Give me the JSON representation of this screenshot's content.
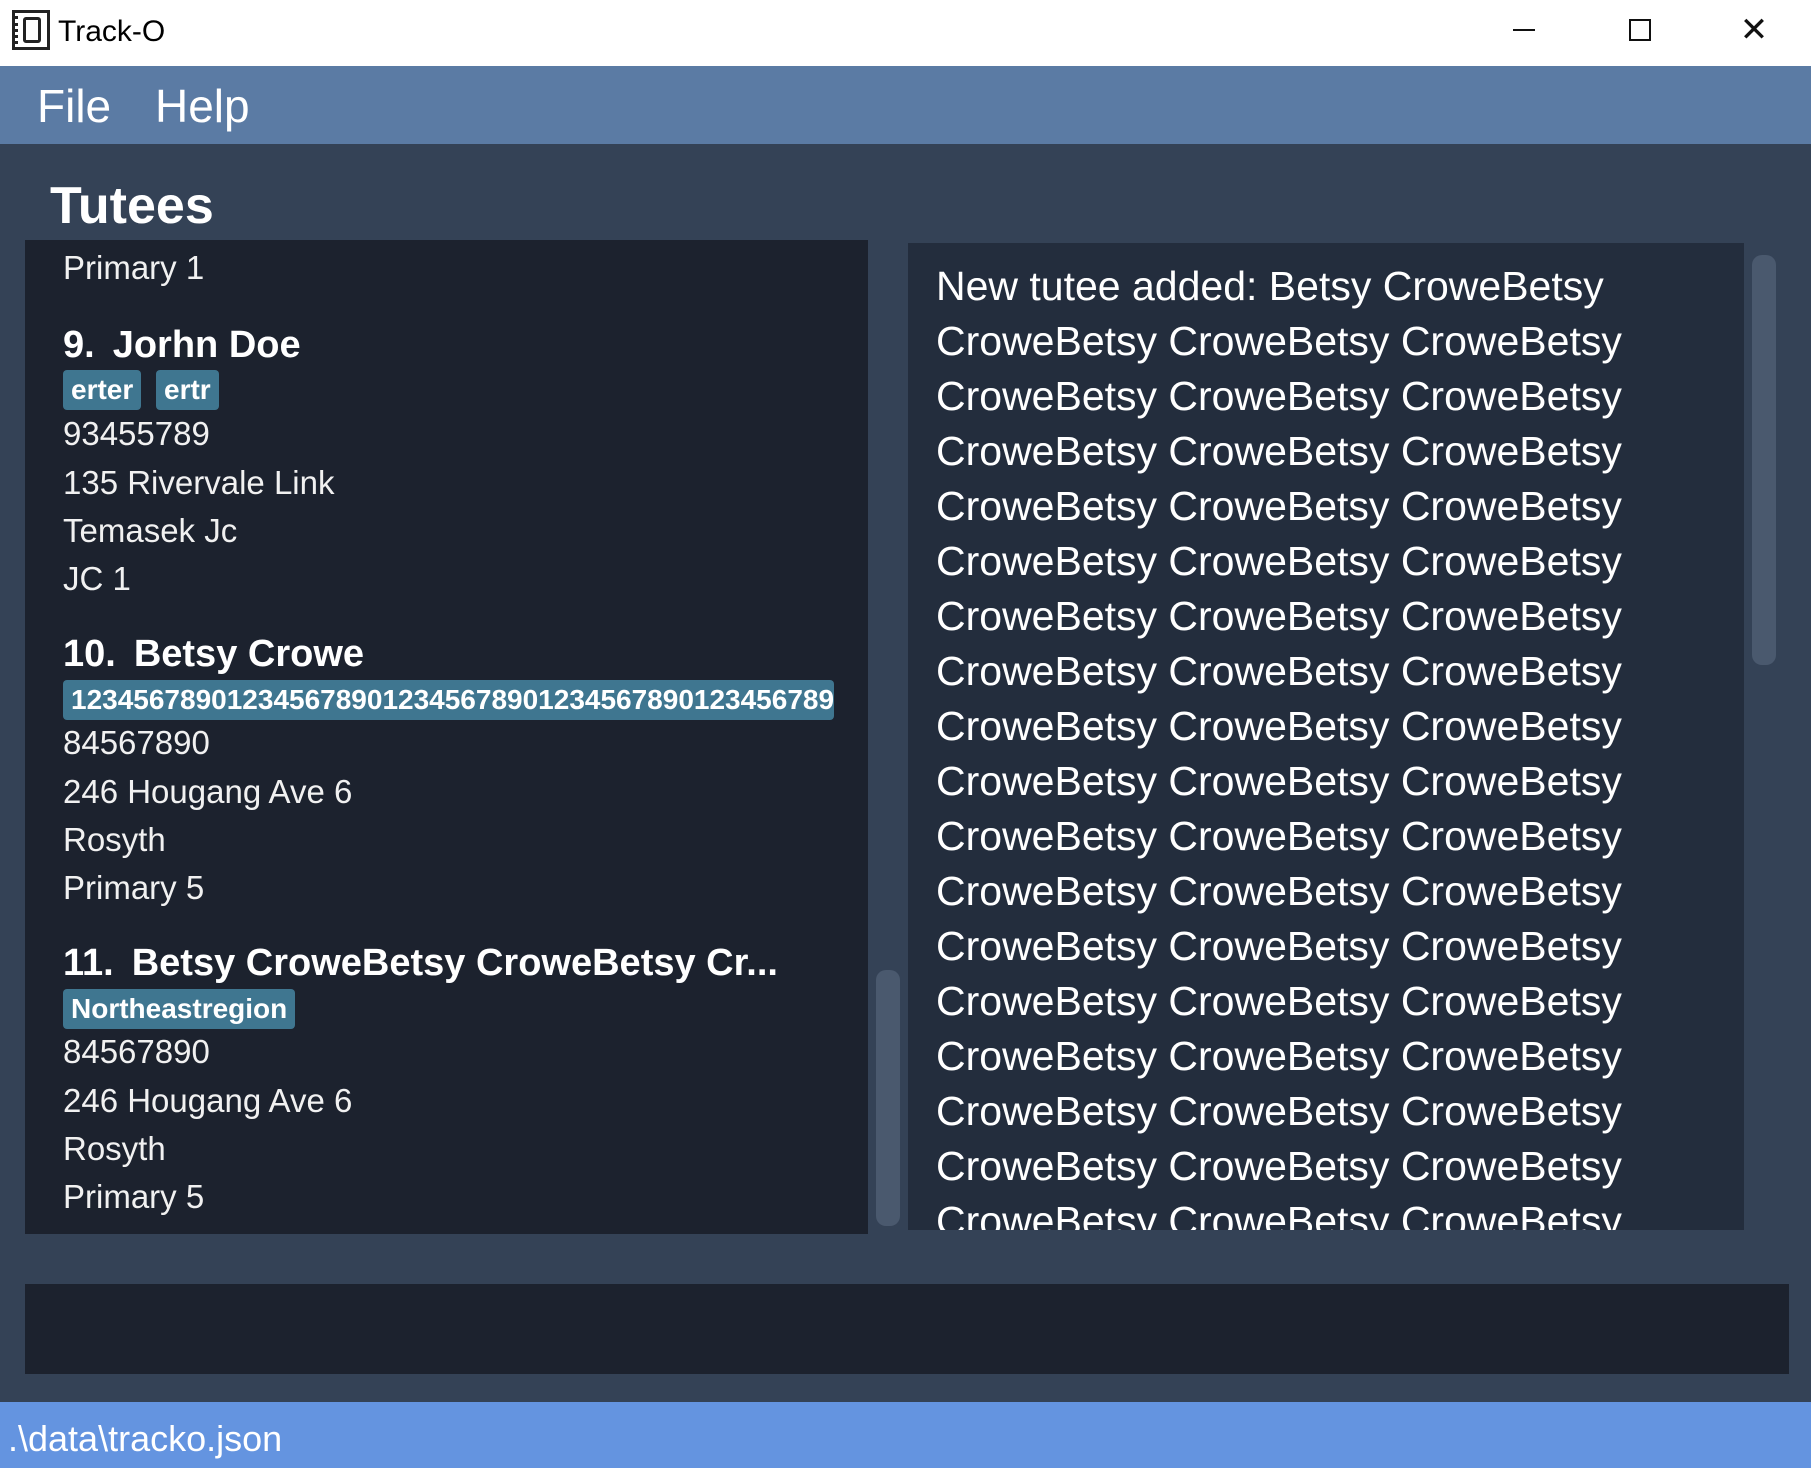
{
  "window": {
    "title": "Track-O",
    "minimize_label": "",
    "maximize_label": "",
    "close_glyph": "✕"
  },
  "menu": {
    "file": "File",
    "help": "Help"
  },
  "heading": "Tutees",
  "tutees": {
    "prev_tail": "Primary 1",
    "t9": {
      "index": "9.",
      "name": "Jorhn Doe",
      "tags": [
        "erter",
        "ertr"
      ],
      "phone": "93455789",
      "address": "135 Rivervale Link",
      "school": "Temasek Jc",
      "level": "JC 1"
    },
    "t10": {
      "index": "10.",
      "name": "Betsy Crowe",
      "tags": [
        "1234567890123456789012345678901234567890123456789"
      ],
      "phone": "84567890",
      "address": "246 Hougang Ave 6",
      "school": "Rosyth",
      "level": "Primary 5"
    },
    "t11": {
      "index": "11.",
      "name": "Betsy CroweBetsy CroweBetsy Cr...",
      "tags": [
        "Northeastregion"
      ],
      "phone": "84567890",
      "address": "246 Hougang Ave 6",
      "school": "Rosyth",
      "level": "Primary 5"
    }
  },
  "result": {
    "lines": [
      "New tutee added: Betsy CroweBetsy",
      "CroweBetsy CroweBetsy CroweBetsy",
      "CroweBetsy CroweBetsy CroweBetsy",
      "CroweBetsy CroweBetsy CroweBetsy",
      "CroweBetsy CroweBetsy CroweBetsy",
      "CroweBetsy CroweBetsy CroweBetsy",
      "CroweBetsy CroweBetsy CroweBetsy",
      "CroweBetsy CroweBetsy CroweBetsy",
      "CroweBetsy CroweBetsy CroweBetsy",
      "CroweBetsy CroweBetsy CroweBetsy",
      "CroweBetsy CroweBetsy CroweBetsy",
      "CroweBetsy CroweBetsy CroweBetsy",
      "CroweBetsy CroweBetsy CroweBetsy",
      "CroweBetsy CroweBetsy CroweBetsy",
      "CroweBetsy CroweBetsy CroweBetsy",
      "CroweBetsy CroweBetsy CroweBetsy",
      "CroweBetsy CroweBetsy CroweBetsy",
      "CroweBetsy CroweBetsy CroweBetsy"
    ]
  },
  "command": {
    "value": ""
  },
  "status": {
    "file_path": ".\\data\\tracko.json"
  },
  "colors": {
    "background": "#344256",
    "menubar": "#5b7ba4",
    "list_bg": "#1c222e",
    "result_bg": "#232d3d",
    "tag_bg": "#3f7690",
    "statusbar": "#6494e0"
  }
}
